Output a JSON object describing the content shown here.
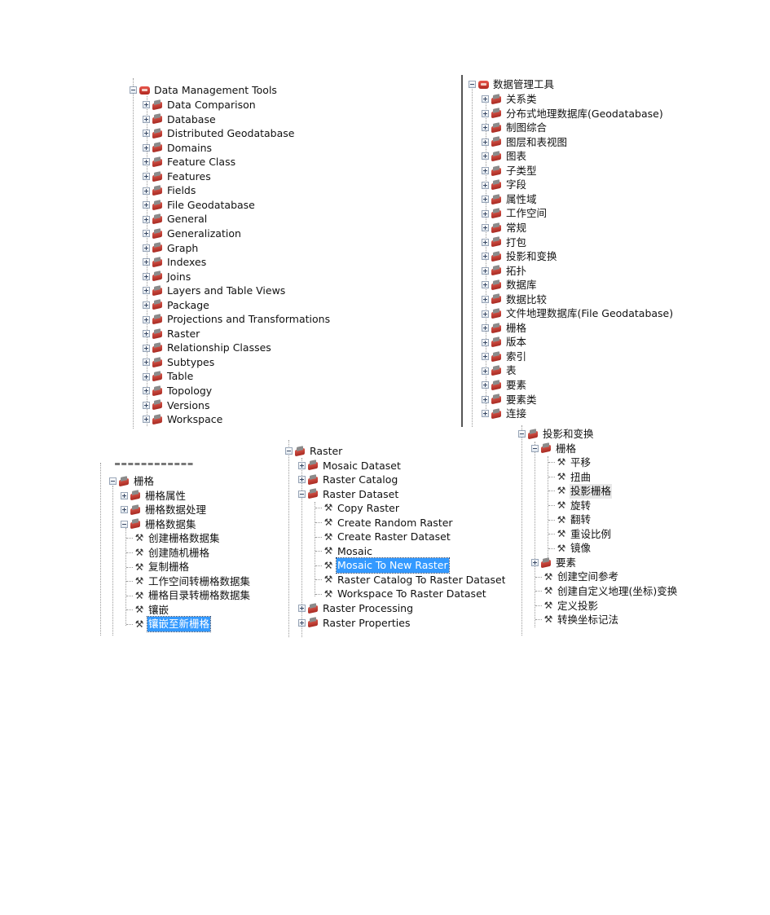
{
  "panel_en_top": {
    "root": "Data Management Tools",
    "items": [
      "Data Comparison",
      "Database",
      "Distributed Geodatabase",
      "Domains",
      "Feature Class",
      "Features",
      "Fields",
      "File Geodatabase",
      "General",
      "Generalization",
      "Graph",
      "Indexes",
      "Joins",
      "Layers and Table Views",
      "Package",
      "Projections and Transformations",
      "Raster",
      "Relationship Classes",
      "Subtypes",
      "Table",
      "Topology",
      "Versions",
      "Workspace"
    ]
  },
  "panel_cn_top": {
    "root": "数据管理工具",
    "items": [
      "关系类",
      "分布式地理数据库(Geodatabase)",
      "制图综合",
      "图层和表视图",
      "图表",
      "子类型",
      "字段",
      "属性域",
      "工作空间",
      "常规",
      "打包",
      "投影和变换",
      "拓扑",
      "数据库",
      "数据比较",
      "文件地理数据库(File Geodatabase)",
      "栅格",
      "版本",
      "索引",
      "表",
      "要素",
      "要素类",
      "连接"
    ]
  },
  "panel_cn_raster": {
    "root": "栅格",
    "toolsets": [
      {
        "label": "栅格属性",
        "expanded": false
      },
      {
        "label": "栅格数据处理",
        "expanded": false
      },
      {
        "label": "栅格数据集",
        "expanded": true
      }
    ],
    "tools": [
      "创建栅格数据集",
      "创建随机栅格",
      "复制栅格",
      "工作空间转栅格数据集",
      "栅格目录转栅格数据集",
      "镶嵌",
      "镶嵌至新栅格"
    ],
    "selected_tool": "镶嵌至新栅格"
  },
  "panel_en_raster": {
    "root": "Raster",
    "toolsets_before": [
      "Mosaic Dataset",
      "Raster Catalog"
    ],
    "expanded_toolset": "Raster Dataset",
    "tools": [
      "Copy Raster",
      "Create Random Raster",
      "Create Raster Dataset",
      "Mosaic",
      "Mosaic To New Raster",
      "Raster Catalog To Raster Dataset",
      "Workspace To Raster Dataset"
    ],
    "selected_tool": "Mosaic To New Raster",
    "toolsets_after": [
      "Raster Processing",
      "Raster Properties"
    ]
  },
  "panel_cn_proj": {
    "root": "投影和变换",
    "raster_toolset": "栅格",
    "raster_tools": [
      "平移",
      "扭曲",
      "投影栅格",
      "旋转",
      "翻转",
      "重设比例",
      "镜像"
    ],
    "hover_tool": "投影栅格",
    "features_toolset": "要素",
    "tools": [
      "创建空间参考",
      "创建自定义地理(坐标)变换",
      "定义投影",
      "转换坐标记法"
    ]
  }
}
